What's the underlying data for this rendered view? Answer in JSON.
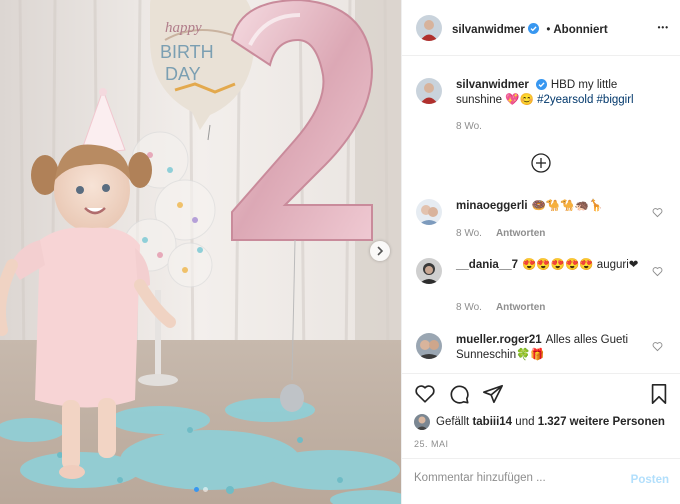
{
  "post": {
    "author": "silvanwidmer",
    "follow_status": "Abonniert",
    "follow_separator": "•",
    "more_glyph": "•••",
    "caption_text": "HBD my little sunshine 💖😊",
    "caption_hashtags": "#2yearsold #biggirl",
    "caption_time": "8 Wo.",
    "photo_text": "happy BIRTHDAY",
    "carousel": {
      "count": 2,
      "active": 0
    }
  },
  "comments": [
    {
      "user": "minaoeggerli",
      "text": "🍩🐪🐪🦔🦒",
      "time": "8 Wo.",
      "reply": "Antworten"
    },
    {
      "user": "__dania__7",
      "text": "😍😍😍😍😍 auguri❤",
      "time": "8 Wo.",
      "reply": "Antworten"
    },
    {
      "user": "mueller.roger21",
      "text": "Alles alles Gueti Sunneschin🍀🎁",
      "time": "",
      "reply": ""
    }
  ],
  "likes": {
    "prefix": "Gefällt",
    "first_user": "tabiii14",
    "connector": "und",
    "count_text": "1.327 weitere Personen"
  },
  "date": "25. MAI",
  "composer": {
    "placeholder": "Kommentar hinzufügen ...",
    "post_label": "Posten"
  },
  "colors": {
    "link": "#00376b",
    "muted": "#8e8e8e",
    "verified": "#3897f0",
    "post_disabled": "#b2dffc"
  },
  "icons": [
    "verified-badge-icon",
    "more-options-icon",
    "load-more-comments-icon",
    "heart-icon",
    "comment-icon",
    "share-icon",
    "bookmark-icon",
    "chevron-right-icon"
  ]
}
